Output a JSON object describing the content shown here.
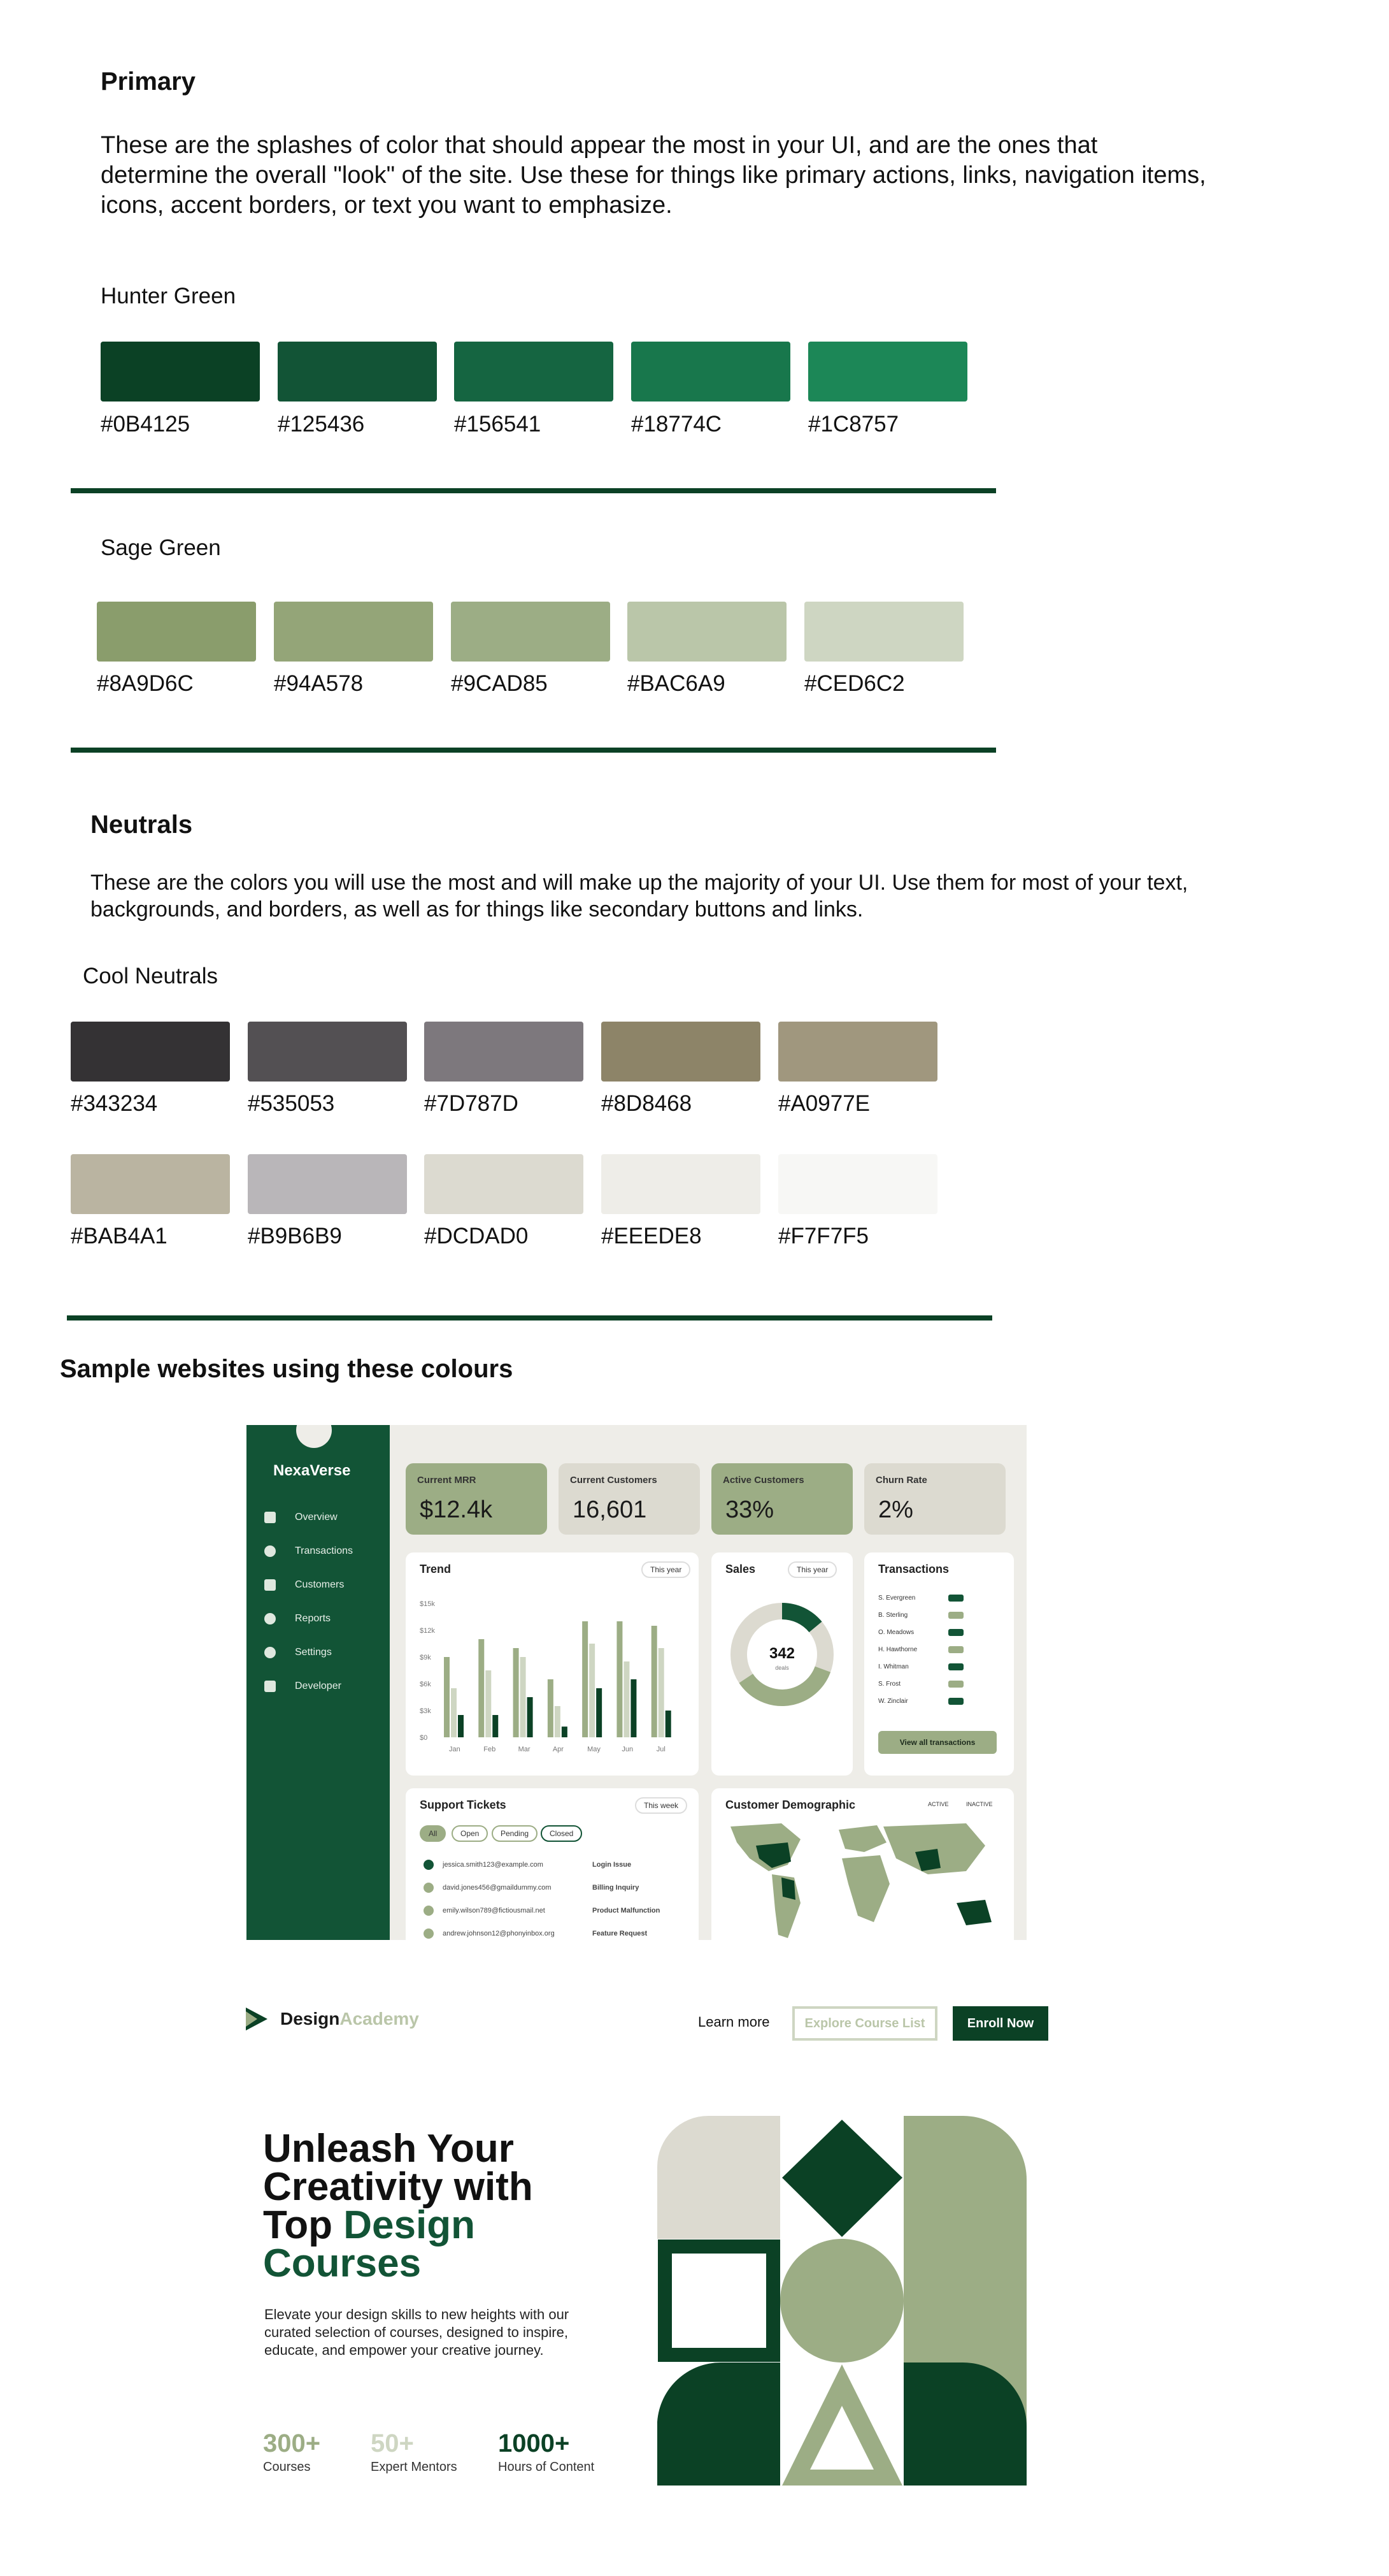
{
  "primary": {
    "heading": "Primary",
    "description": "These are the splashes of color that should appear the most in your UI, and are the ones that determine the overall \"look\" of the site. Use these for things like primary actions, links, navigation items, icons, accent borders, or text you want to emphasize.",
    "hunter_label": "Hunter Green",
    "hunter": [
      "#0B4125",
      "#125436",
      "#156541",
      "#18774C",
      "#1C8757"
    ],
    "sage_label": "Sage Green",
    "sage": [
      "#8A9D6C",
      "#94A578",
      "#9CAD85",
      "#BAC6A9",
      "#CED6C2"
    ]
  },
  "neutrals": {
    "heading": "Neutrals",
    "description": "These are the colors you will use the most and will make up the majority of your UI. Use them for most of your text, backgrounds, and borders, as well as for things like secondary buttons and links.",
    "cool_label": "Cool Neutrals",
    "row1": [
      "#343234",
      "#535053",
      "#7D787D",
      "#8D8468",
      "#A0977E"
    ],
    "row2": [
      "#BAB4A1",
      "#B9B6B9",
      "#DCDAD0",
      "#EEEDE8",
      "#F7F7F5"
    ]
  },
  "samples_heading": "Sample websites using these colours",
  "dashboard": {
    "brand": "NexaVerse",
    "nav": [
      "Overview",
      "Transactions",
      "Customers",
      "Reports",
      "Settings",
      "Developer"
    ],
    "kpis": [
      {
        "title": "Current MRR",
        "value": "$12.4k",
        "color": "#9CAD85"
      },
      {
        "title": "Current Customers",
        "value": "16,601",
        "color": "#DCDAD0"
      },
      {
        "title": "Active Customers",
        "value": "33%",
        "color": "#9CAD85"
      },
      {
        "title": "Churn Rate",
        "value": "2%",
        "color": "#DCDAD0"
      }
    ],
    "trend": {
      "title": "Trend",
      "filter": "This year",
      "months": [
        "Jan",
        "Feb",
        "Mar",
        "Apr",
        "May",
        "Jun",
        "Jul"
      ],
      "ticks": [
        "$15k",
        "$12k",
        "$9k",
        "$6k",
        "$3k",
        "$0"
      ],
      "series": [
        [
          9,
          11,
          10,
          6.5,
          13,
          13,
          12.5
        ],
        [
          5.5,
          7.5,
          9,
          3.5,
          10.5,
          8.5,
          10
        ],
        [
          2.5,
          2.5,
          4.5,
          1.2,
          5.5,
          6.5,
          3
        ]
      ]
    },
    "sales": {
      "title": "Sales",
      "filter": "This year",
      "value": "342",
      "sub": "deals"
    },
    "transactions": {
      "title": "Transactions",
      "names": [
        "S. Evergreen",
        "B. Sterling",
        "O. Meadows",
        "H. Hawthorne",
        "I. Whitman",
        "S. Frost",
        "W. Zinclair"
      ],
      "button": "View all transactions"
    },
    "tickets": {
      "title": "Support Tickets",
      "filter": "This week",
      "pills": [
        "All",
        "Open",
        "Pending",
        "Closed"
      ],
      "rows": [
        {
          "email": "jessica.smith123@example.com",
          "issue": "Login Issue"
        },
        {
          "email": "david.jones456@gmaildummy.com",
          "issue": "Billing Inquiry"
        },
        {
          "email": "emily.wilson789@fictiousmail.net",
          "issue": "Product Malfunction"
        },
        {
          "email": "andrew.johnson12@phonyinbox.org",
          "issue": "Feature Request"
        }
      ]
    },
    "demographic": {
      "title": "Customer Demographic",
      "legend": [
        "ACTIVE",
        "INACTIVE"
      ]
    }
  },
  "academy": {
    "brand_a": "Design",
    "brand_b": "Academy",
    "learn": "Learn more",
    "explore": "Explore Course List",
    "enroll": "Enroll Now",
    "h1": "Unleash Your",
    "h2": "Creativity with",
    "h3a": "Top ",
    "h3b": "Design",
    "h4": "Courses",
    "body": "Elevate your design skills to new heights with our curated selection of courses, designed to inspire, educate, and empower your creative journey.",
    "stats": [
      {
        "value": "300+",
        "label": "Courses"
      },
      {
        "value": "50+",
        "label": "Expert Mentors"
      },
      {
        "value": "1000+",
        "label": "Hours of Content"
      }
    ]
  }
}
